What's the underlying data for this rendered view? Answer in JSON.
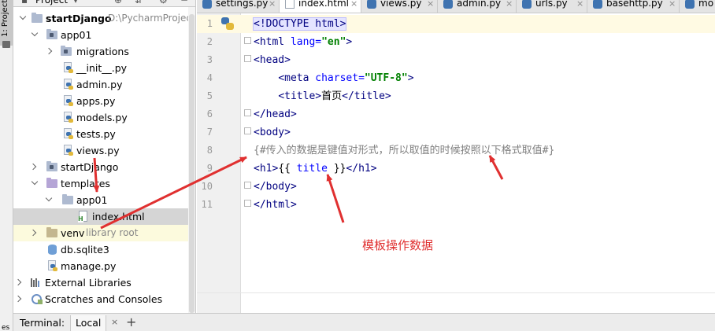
{
  "stripe": {
    "project": "1: Project",
    "bottom": "es"
  },
  "project_panel": {
    "title": "Project"
  },
  "tree": [
    {
      "label": "startDjango",
      "sub": "D:\\PycharmProjects"
    },
    {
      "label": "app01"
    },
    {
      "label": "migrations"
    },
    {
      "label": "__init__.py"
    },
    {
      "label": "admin.py"
    },
    {
      "label": "apps.py"
    },
    {
      "label": "models.py"
    },
    {
      "label": "tests.py"
    },
    {
      "label": "views.py"
    },
    {
      "label": "startDjango"
    },
    {
      "label": "templates"
    },
    {
      "label": "app01"
    },
    {
      "label": "index.html"
    },
    {
      "label": "venv",
      "sub": "library root"
    },
    {
      "label": "db.sqlite3"
    },
    {
      "label": "manage.py"
    },
    {
      "label": "External Libraries"
    },
    {
      "label": "Scratches and Consoles"
    }
  ],
  "tabs": [
    {
      "label": "settings.py"
    },
    {
      "label": "index.html"
    },
    {
      "label": "views.py"
    },
    {
      "label": "admin.py"
    },
    {
      "label": "urls.py"
    },
    {
      "label": "basehttp.py"
    },
    {
      "label": "mo"
    }
  ],
  "code": {
    "line_numbers": [
      "1",
      "2",
      "3",
      "4",
      "5",
      "6",
      "7",
      "8",
      "9",
      "10",
      "11"
    ],
    "l1": {
      "text": "<!DOCTYPE html>"
    },
    "l2": {
      "open": "<html ",
      "attr": "lang",
      "eq": "=",
      "val": "\"en\"",
      "close": ">"
    },
    "l3": {
      "text": "<head>"
    },
    "l4": {
      "indent": "    ",
      "open": "<meta ",
      "attr": "charset",
      "eq": "=",
      "val": "\"UTF-8\"",
      "close": ">"
    },
    "l5": {
      "indent": "    ",
      "open": "<title>",
      "text": "首页",
      "close": "</title>"
    },
    "l6": {
      "text": "</head>"
    },
    "l7": {
      "text": "<body>"
    },
    "l8": {
      "text": "{#传入的数据是键值对形式，所以取值的时候按照以下格式取值#}"
    },
    "l9": {
      "open": "<h1>",
      "mo": "{{ ",
      "var": "title",
      "mc": " }}",
      "close": "</h1>"
    },
    "l10": {
      "text": "</body>"
    },
    "l11": {
      "text": "</html>"
    }
  },
  "annotation": "模板操作数据",
  "terminal": {
    "label": "Terminal:",
    "tab": "Local",
    "close": "×",
    "add": "+"
  },
  "colors": {
    "arrow": "#e03030",
    "annotation": "#e03030",
    "tag": "#000080",
    "attr": "#0000ff",
    "string": "#008000",
    "comment": "#808080"
  },
  "icons": {
    "tree_chevron": "chevron-icon",
    "folder": "folder-icon",
    "python": "python-file-icon",
    "html": "html-file-icon",
    "db": "database-icon"
  }
}
